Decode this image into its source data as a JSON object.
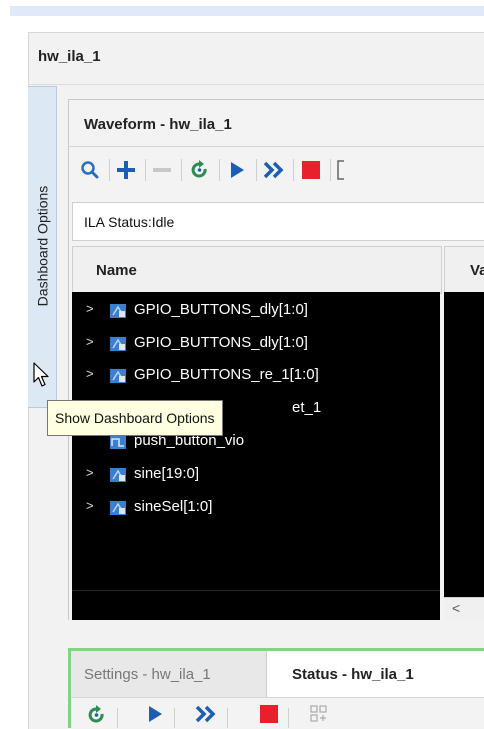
{
  "outer_panel": {
    "title": "hw_ila_1"
  },
  "side_tab": {
    "label": "Dashboard Options"
  },
  "waveform": {
    "title": "Waveform - hw_ila_1",
    "toolbar_icons": [
      "zoom-icon",
      "add-icon",
      "remove-icon",
      "refresh-icon",
      "run-icon",
      "run-all-icon",
      "stop-icon"
    ],
    "ila_status": "ILA Status:Idle",
    "columns": {
      "name": "Name",
      "value": "Va"
    },
    "signals": [
      {
        "label": "GPIO_BUTTONS_dly[1:0]"
      },
      {
        "label": "GPIO_BUTTONS_dly[1:0]"
      },
      {
        "label": "GPIO_BUTTONS_re_1[1:0]"
      },
      {
        "label": "et_1"
      },
      {
        "label": "push_button_vio"
      },
      {
        "label": "sine[19:0]"
      },
      {
        "label": "sineSel[1:0]"
      }
    ],
    "scroll_left": "<"
  },
  "tooltip": {
    "text": "Show Dashboard Options"
  },
  "bottom_panel": {
    "tabs": [
      {
        "label": "Settings - hw_ila_1",
        "active": false
      },
      {
        "label": "Status - hw_ila_1",
        "active": true
      }
    ]
  },
  "colors": {
    "accent_blue": "#2a6ebb",
    "run_blue": "#1a5fb4",
    "stop_red": "#e8202a",
    "refresh_green": "#2e8b57",
    "highlight_green": "#7fd67f"
  }
}
